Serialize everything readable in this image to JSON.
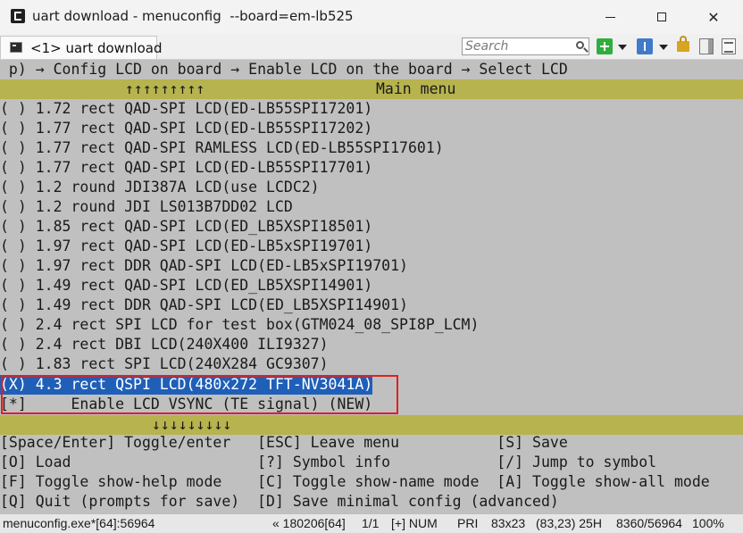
{
  "window": {
    "title": "uart download - menuconfig  --board=em-lb525",
    "minimize_glyph": "",
    "close_glyph": "✕"
  },
  "tab": {
    "label": "<1> uart download"
  },
  "search": {
    "placeholder": "Search"
  },
  "terminal": {
    "breadcrumb": " p) → Config LCD on board → Enable LCD on the board → Select LCD",
    "scroll_up": "↑↑↑↑↑↑↑↑↑",
    "menu_title": "Main menu",
    "items": [
      "( ) 1.72 rect QAD-SPI LCD(ED-LB55SPI17201)",
      "( ) 1.77 rect QAD-SPI LCD(ED-LB55SPI17202)",
      "( ) 1.77 rect QAD-SPI RAMLESS LCD(ED-LB55SPI17601)",
      "( ) 1.77 rect QAD-SPI LCD(ED-LB55SPI17701)",
      "( ) 1.2 round JDI387A LCD(use LCDC2)",
      "( ) 1.2 round JDI LS013B7DD02 LCD",
      "( ) 1.85 rect QAD-SPI LCD(ED_LB5XSPI18501)",
      "( ) 1.97 rect QAD-SPI LCD(ED-LB5xSPI19701)",
      "( ) 1.97 rect DDR QAD-SPI LCD(ED-LB5xSPI19701)",
      "( ) 1.49 rect QAD-SPI LCD(ED_LB5XSPI14901)",
      "( ) 1.49 rect DDR QAD-SPI LCD(ED_LB5XSPI14901)",
      "( ) 2.4 rect SPI LCD for test box(GTM024_08_SPI8P_LCM)",
      "( ) 2.4 rect DBI LCD(240X400 ILI9327)",
      "( ) 1.83 rect SPI LCD(240X284 GC9307)"
    ],
    "selected_item": "(X) 4.3 rect QSPI LCD(480x272 TFT-NV3041A)",
    "option_item": "[*]     Enable LCD VSYNC (TE signal) (NEW)",
    "scroll_down": "↓↓↓↓↓↓↓↓↓",
    "help": [
      "[Space/Enter] Toggle/enter   [ESC] Leave menu           [S] Save",
      "[O] Load                     [?] Symbol info            [/] Jump to symbol",
      "[F] Toggle show-help mode    [C] Toggle show-name mode  [A] Toggle show-all mode",
      "[Q] Quit (prompts for save)  [D] Save minimal config (advanced)"
    ]
  },
  "statusbar": {
    "process": "menuconfig.exe*[64]:56964",
    "build": "« 180206[64]",
    "page": "1/1",
    "insert": "[+] NUM",
    "pri": "PRI",
    "size": "83x23",
    "cursor": "(83,23) 25H",
    "memory": "8360/56964",
    "zoom": "100%"
  },
  "colors": {
    "terminal_bg": "#c0c0c0",
    "title_bar_olive": "#b7b34e",
    "selection_blue": "#1f5fb8",
    "highlight_red": "#e02020"
  }
}
